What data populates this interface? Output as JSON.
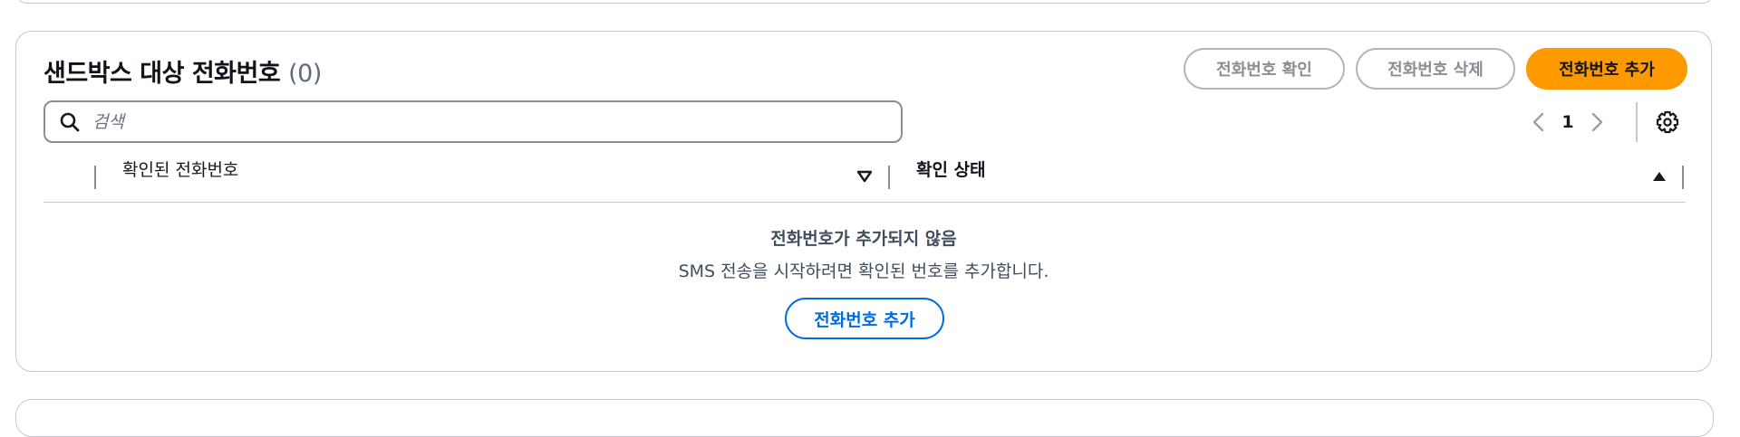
{
  "panel": {
    "title": "샌드박스 대상 전화번호",
    "count": "(0)"
  },
  "actions": {
    "verify_label": "전화번호 확인",
    "delete_label": "전화번호 삭제",
    "add_label": "전화번호 추가"
  },
  "search": {
    "placeholder": "검색",
    "value": ""
  },
  "pagination": {
    "current_page": "1"
  },
  "table": {
    "columns": [
      {
        "label": "확인된 전화번호",
        "sort": "descending-outline"
      },
      {
        "label": "확인 상태",
        "sort": "ascending"
      }
    ],
    "rows": []
  },
  "empty_state": {
    "title": "전화번호가 추가되지 않음",
    "description": "SMS 전송을 시작하려면 확인된 번호를 추가합니다.",
    "button_label": "전화번호 추가"
  },
  "colors": {
    "primary": "#ff9900",
    "link": "#006ce0",
    "border": "#c6c6cd",
    "disabled_text": "#8c8c94"
  },
  "icons": [
    "search-icon",
    "chevron-left-icon",
    "chevron-right-icon",
    "gear-icon",
    "sort-down-outline-icon",
    "sort-up-filled-icon"
  ]
}
